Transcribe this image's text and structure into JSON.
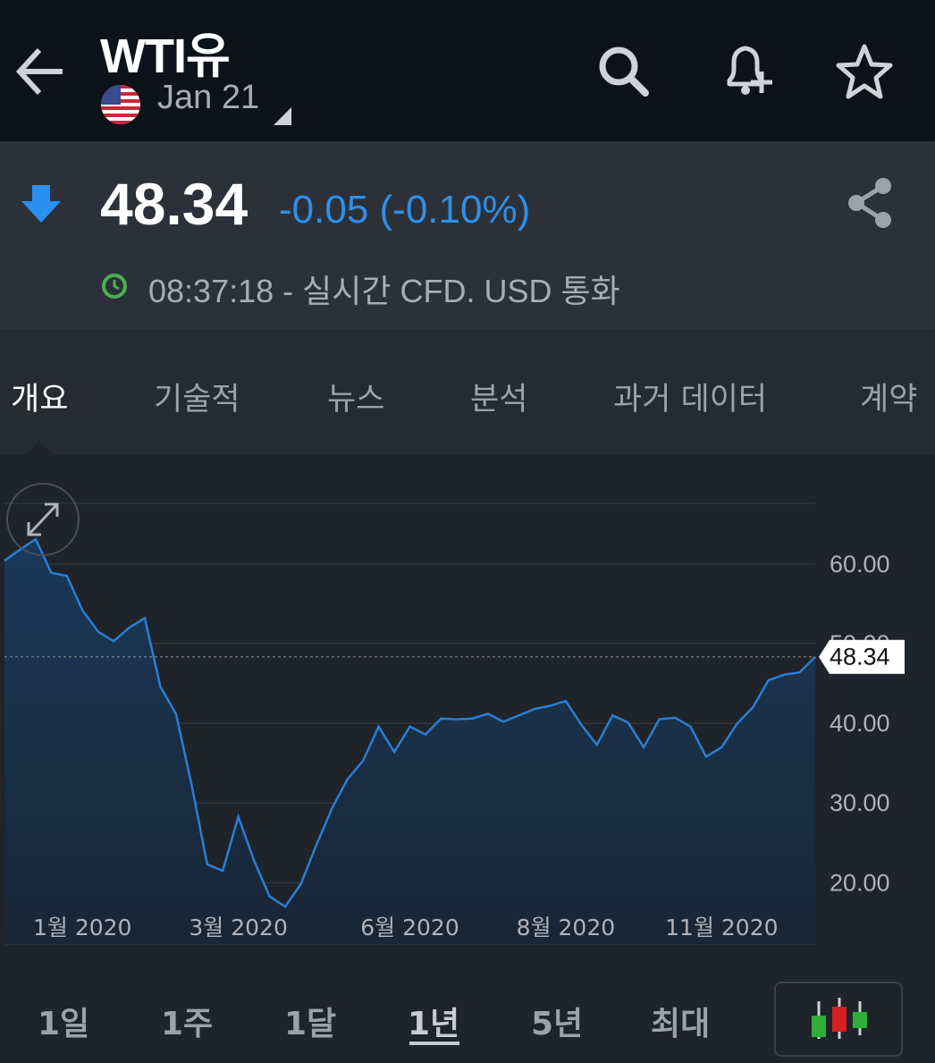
{
  "header": {
    "title": "WTI유",
    "contract": "Jan 21",
    "flag_icon": "us-flag-icon",
    "icons": [
      "back-arrow-icon",
      "search-icon",
      "bell-plus-icon",
      "star-icon"
    ]
  },
  "quote": {
    "price": "48.34",
    "change": "-0.05 (-0.10%)",
    "direction": "down",
    "status": "08:37:18 - 실시간 CFD. USD 통화",
    "accent_color": "#2f8fe6",
    "clock_color": "#4caf50"
  },
  "tabs": [
    {
      "label": "개요",
      "active": true
    },
    {
      "label": "기술적",
      "active": false
    },
    {
      "label": "뉴스",
      "active": false
    },
    {
      "label": "분석",
      "active": false
    },
    {
      "label": "과거 데이터",
      "active": false
    },
    {
      "label": "계약",
      "active": false
    }
  ],
  "ranges": [
    {
      "label": "1일",
      "active": false
    },
    {
      "label": "1주",
      "active": false
    },
    {
      "label": "1달",
      "active": false
    },
    {
      "label": "1년",
      "active": true
    },
    {
      "label": "5년",
      "active": false
    },
    {
      "label": "최대",
      "active": false
    }
  ],
  "chart_data": {
    "type": "area",
    "y_ticks": [
      "20.00",
      "30.00",
      "40.00",
      "50.00",
      "60.00"
    ],
    "ylim": [
      12.3,
      67.6
    ],
    "x_tick_labels": [
      "1월 2020",
      "3월 2020",
      "6월 2020",
      "8월 2020",
      "11월 2020"
    ],
    "x_tick_index": [
      5,
      15,
      26,
      36,
      46
    ],
    "last_value_label": "48.34",
    "last_value": 48.34,
    "line_color": "#2a7fd4",
    "values": [
      60.4,
      61.8,
      63.1,
      58.9,
      58.5,
      54.2,
      51.5,
      50.3,
      52.0,
      53.2,
      44.6,
      41.2,
      32.3,
      22.3,
      21.5,
      28.3,
      22.8,
      18.3,
      17.0,
      19.8,
      24.7,
      29.3,
      33.0,
      35.3,
      39.6,
      36.4,
      39.6,
      38.6,
      40.6,
      40.5,
      40.6,
      41.2,
      40.2,
      41.0,
      41.8,
      42.2,
      42.8,
      39.8,
      37.3,
      41.0,
      40.1,
      37.0,
      40.5,
      40.7,
      39.6,
      35.8,
      37.0,
      40.0,
      42.0,
      45.4,
      46.1,
      46.4,
      48.34
    ],
    "grid": true
  }
}
